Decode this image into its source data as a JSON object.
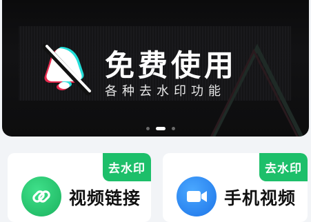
{
  "banner": {
    "title": "免费使用",
    "subtitle": "各种去水印功能",
    "pagination_total": 3,
    "pagination_active": 2
  },
  "features": [
    {
      "label": "视频链接",
      "badge": "去水印",
      "icon": "link-icon",
      "color": "#1dbf6a"
    },
    {
      "label": "手机视频",
      "badge": "去水印",
      "icon": "video-camera-icon",
      "color": "#1d74e8"
    }
  ],
  "colors": {
    "badge_green": "#1dbf6a",
    "banner_bg": "#0d0d0e",
    "page_bg": "#f2f4f7"
  }
}
